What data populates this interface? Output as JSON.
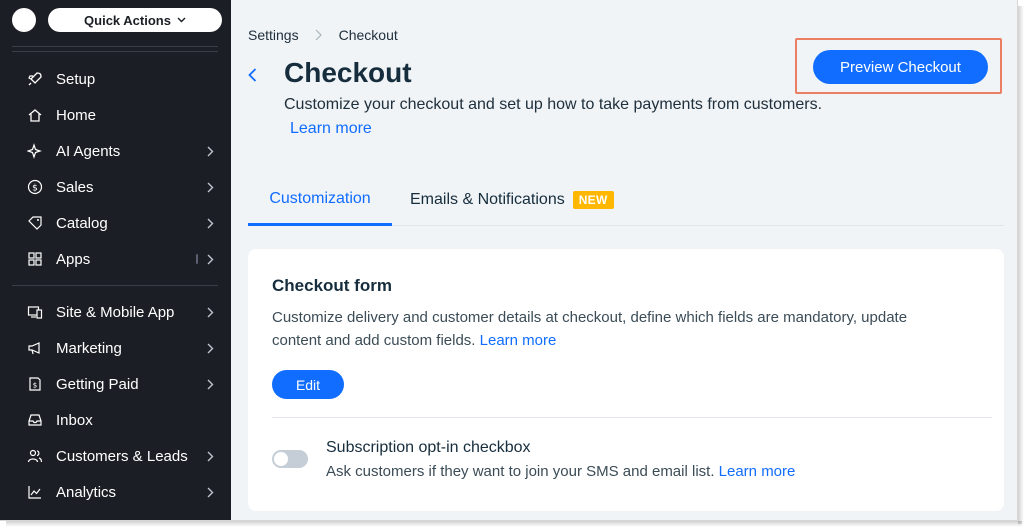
{
  "sidebar": {
    "quick_actions": "Quick Actions",
    "items": [
      {
        "label": "Setup",
        "icon": "rocket-icon",
        "arrow": false
      },
      {
        "label": "Home",
        "icon": "home-icon",
        "arrow": false
      },
      {
        "label": "AI Agents",
        "icon": "sparkle-icon",
        "arrow": true
      },
      {
        "label": "Sales",
        "icon": "dollar-icon",
        "arrow": true
      },
      {
        "label": "Catalog",
        "icon": "tag-icon",
        "arrow": true
      },
      {
        "label": "Apps",
        "icon": "apps-icon",
        "arrow": true
      },
      {
        "label": "Site & Mobile App",
        "icon": "devices-icon",
        "arrow": true
      },
      {
        "label": "Marketing",
        "icon": "megaphone-icon",
        "arrow": true
      },
      {
        "label": "Getting Paid",
        "icon": "invoice-icon",
        "arrow": true
      },
      {
        "label": "Inbox",
        "icon": "inbox-icon",
        "arrow": false
      },
      {
        "label": "Customers & Leads",
        "icon": "people-icon",
        "arrow": true
      },
      {
        "label": "Analytics",
        "icon": "chart-icon",
        "arrow": true
      }
    ]
  },
  "breadcrumb": {
    "parent": "Settings",
    "current": "Checkout"
  },
  "page": {
    "title": "Checkout",
    "subtitle": "Customize your checkout and set up how to take payments from customers.",
    "learn_more": "Learn more",
    "preview_button": "Preview Checkout"
  },
  "tabs": {
    "customization": "Customization",
    "emails": "Emails & Notifications",
    "new_badge": "NEW"
  },
  "checkout_form": {
    "title": "Checkout form",
    "description": "Customize delivery and customer details at checkout, define which fields are mandatory, update content  and add custom fields.",
    "learn_more": "Learn more",
    "edit_button": "Edit"
  },
  "subscription": {
    "title": "Subscription opt-in checkbox",
    "description": "Ask customers if they want to join your SMS and email list.",
    "learn_more": "Learn more",
    "enabled": false
  },
  "colors": {
    "accent": "#116dff",
    "sidebar": "#1b1e24",
    "badge": "#ffb700",
    "highlight": "#ea7f63"
  }
}
